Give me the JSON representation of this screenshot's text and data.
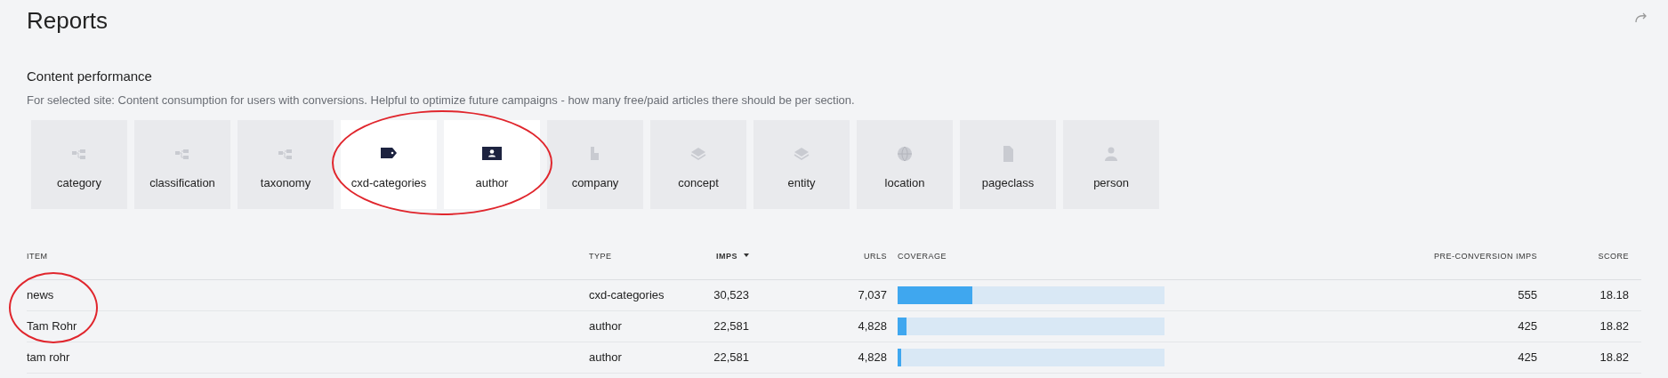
{
  "page": {
    "title": "Reports"
  },
  "section": {
    "title": "Content performance",
    "description": "For selected site: Content consumption for users with conversions. Helpful to optimize future campaigns - how many free/paid articles there should be per section."
  },
  "tiles": [
    {
      "label": "category",
      "kind": "hierarchy",
      "selected": false
    },
    {
      "label": "classification",
      "kind": "hierarchy",
      "selected": false
    },
    {
      "label": "taxonomy",
      "kind": "hierarchy",
      "selected": false
    },
    {
      "label": "cxd-categories",
      "kind": "tag",
      "selected": true
    },
    {
      "label": "author",
      "kind": "badge",
      "selected": true
    },
    {
      "label": "company",
      "kind": "building",
      "selected": false
    },
    {
      "label": "concept",
      "kind": "layers",
      "selected": false
    },
    {
      "label": "entity",
      "kind": "layers",
      "selected": false
    },
    {
      "label": "location",
      "kind": "globe",
      "selected": false
    },
    {
      "label": "pageclass",
      "kind": "document",
      "selected": false
    },
    {
      "label": "person",
      "kind": "person",
      "selected": false
    }
  ],
  "table": {
    "columns": [
      {
        "label": "ITEM",
        "sorted": false
      },
      {
        "label": "TYPE",
        "sorted": false
      },
      {
        "label": "IMPS",
        "sorted": true
      },
      {
        "label": "URLS",
        "sorted": false
      },
      {
        "label": "COVERAGE",
        "sorted": false
      },
      {
        "label": "PRE-CONVERSION IMPS",
        "sorted": false
      },
      {
        "label": "SCORE",
        "sorted": false
      }
    ],
    "rows": [
      {
        "item": "news",
        "type": "cxd-categories",
        "imps": "30,523",
        "urls": "7,037",
        "level": 0.28,
        "pre_conversion_imps": "555",
        "score": "18.18"
      },
      {
        "item": "Tam Rohr",
        "type": "author",
        "imps": "22,581",
        "urls": "4,828",
        "level": 0.033,
        "pre_conversion_imps": "425",
        "score": "18.82"
      },
      {
        "item": "tam rohr",
        "type": "author",
        "imps": "22,581",
        "urls": "4,828",
        "level": 0.013,
        "pre_conversion_imps": "425",
        "score": "18.82"
      }
    ]
  }
}
